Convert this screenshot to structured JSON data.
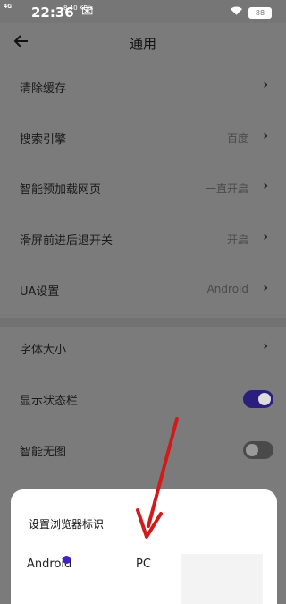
{
  "status_bar": {
    "network": "4G",
    "time": "22:36",
    "speed": "8.40 KB/s",
    "battery": "88"
  },
  "header": {
    "title": "通用"
  },
  "settings": [
    {
      "label": "清除缓存",
      "value": ""
    },
    {
      "label": "搜索引擎",
      "value": "百度"
    },
    {
      "label": "智能预加载网页",
      "value": "一直开启"
    },
    {
      "label": "滑屏前进后退开关",
      "value": "开启"
    },
    {
      "label": "UA设置",
      "value": "Android"
    },
    {
      "label": "字体大小",
      "value": ""
    },
    {
      "label": "显示状态栏",
      "toggle": true
    },
    {
      "label": "智能无图",
      "toggle": false
    }
  ],
  "sheet": {
    "title": "设置浏览器标识",
    "options": [
      "Android",
      "PC"
    ],
    "selected": "Android"
  },
  "colors": {
    "accent": "#3b22c9",
    "annotation_arrow": "#d21a1a"
  }
}
